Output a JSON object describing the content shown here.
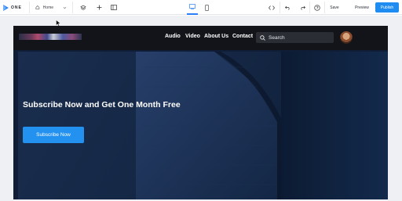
{
  "toolbar": {
    "brand": "ONE",
    "page_selector": "Home",
    "save_label": "Save",
    "preview_label": "Preview",
    "publish_label": "Publish"
  },
  "site": {
    "nav": [
      "Audio",
      "Video",
      "About Us",
      "Contact"
    ],
    "search_placeholder": "Search",
    "hero_title": "Subscribe Now and Get One Month Free",
    "cta_label": "Subscribe Now"
  },
  "colors": {
    "accent": "#1e8cf0",
    "header_bg": "#121419",
    "hero_bg": "#152846"
  }
}
